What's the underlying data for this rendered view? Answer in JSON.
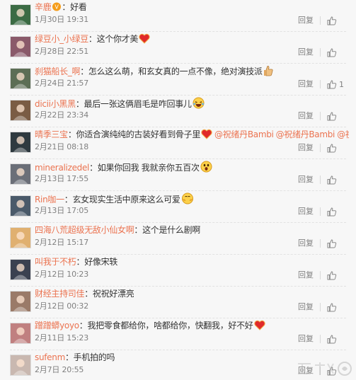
{
  "ui": {
    "reply_label": "回复",
    "colon": "："
  },
  "watermark": {
    "icon": "app-watermark-logo"
  },
  "comments": [
    {
      "user": "辛鹿",
      "badge": "vip-badge-icon",
      "text": "好看",
      "date": "1月30日 19:31",
      "likes": "",
      "avatar_color": "#3b6b44"
    },
    {
      "user": "绿豆小_小绿豆",
      "text": "这个你才美",
      "emoji": "heart",
      "date": "2月28日 22:51",
      "likes": "",
      "avatar_color": "#8a5a6a"
    },
    {
      "user": "刹猫船长_啊",
      "text": "怎么这么萌，和玄女真的一点不像，绝对演技派",
      "emoji": "thumbs-up",
      "date": "2月24日 21:57",
      "likes": "1",
      "avatar_color": "#5c6e55"
    },
    {
      "user": "dicii小黑黑",
      "text": "最后一张这俩眉毛是咋回事儿",
      "emoji": "laughing",
      "date": "2月22日 23:34",
      "likes": "",
      "avatar_color": "#7a5c44"
    },
    {
      "user": "晴季三宝",
      "text": "你适合演纯纯的古装好看到骨子里",
      "emoji": "heart",
      "mentions": [
        "@祝绪丹Bambi",
        "@祝绪丹Bambi",
        "@祝绪丹Bambi"
      ],
      "date": "2月21日 08:18",
      "likes": "",
      "avatar_color": "#2f3a40"
    },
    {
      "user": "mineralizedel",
      "text": "如果你回我 我就亲你五百次",
      "emoji": "surprised",
      "date": "2月13日 17:55",
      "likes": "",
      "avatar_color": "#6b6f78"
    },
    {
      "user": "Rin咖一",
      "text": "玄女现实生活中原来这么可爱",
      "emoji": "hug",
      "date": "2月13日 17:05",
      "likes": "",
      "avatar_color": "#4a5a6a"
    },
    {
      "user": "四海八荒超级无敌小仙女啊",
      "text": "这个是什么剧啊",
      "date": "2月12日 15:17",
      "likes": "",
      "avatar_color": "#e0b070"
    },
    {
      "user": "叫我于不朽",
      "text": "好像宋轶",
      "date": "2月12日 10:23",
      "likes": "",
      "avatar_color": "#3a4150"
    },
    {
      "user": "财经主持司佳",
      "text": "祝祝好漂亮",
      "date": "2月12日 00:32",
      "likes": "",
      "avatar_color": "#9a7a68"
    },
    {
      "user": "蹭蹭蟒yoyo",
      "text": "我把零食都给你，啥都给你，快翻我，好不好",
      "emoji": "heart",
      "date": "2月11日 15:23",
      "likes": "",
      "avatar_color": "#c08080"
    },
    {
      "user": "sufenm",
      "text": "手机拍的吗",
      "date": "2月7日 20:55",
      "likes": "",
      "avatar_color": "#c9b8b0"
    }
  ]
}
